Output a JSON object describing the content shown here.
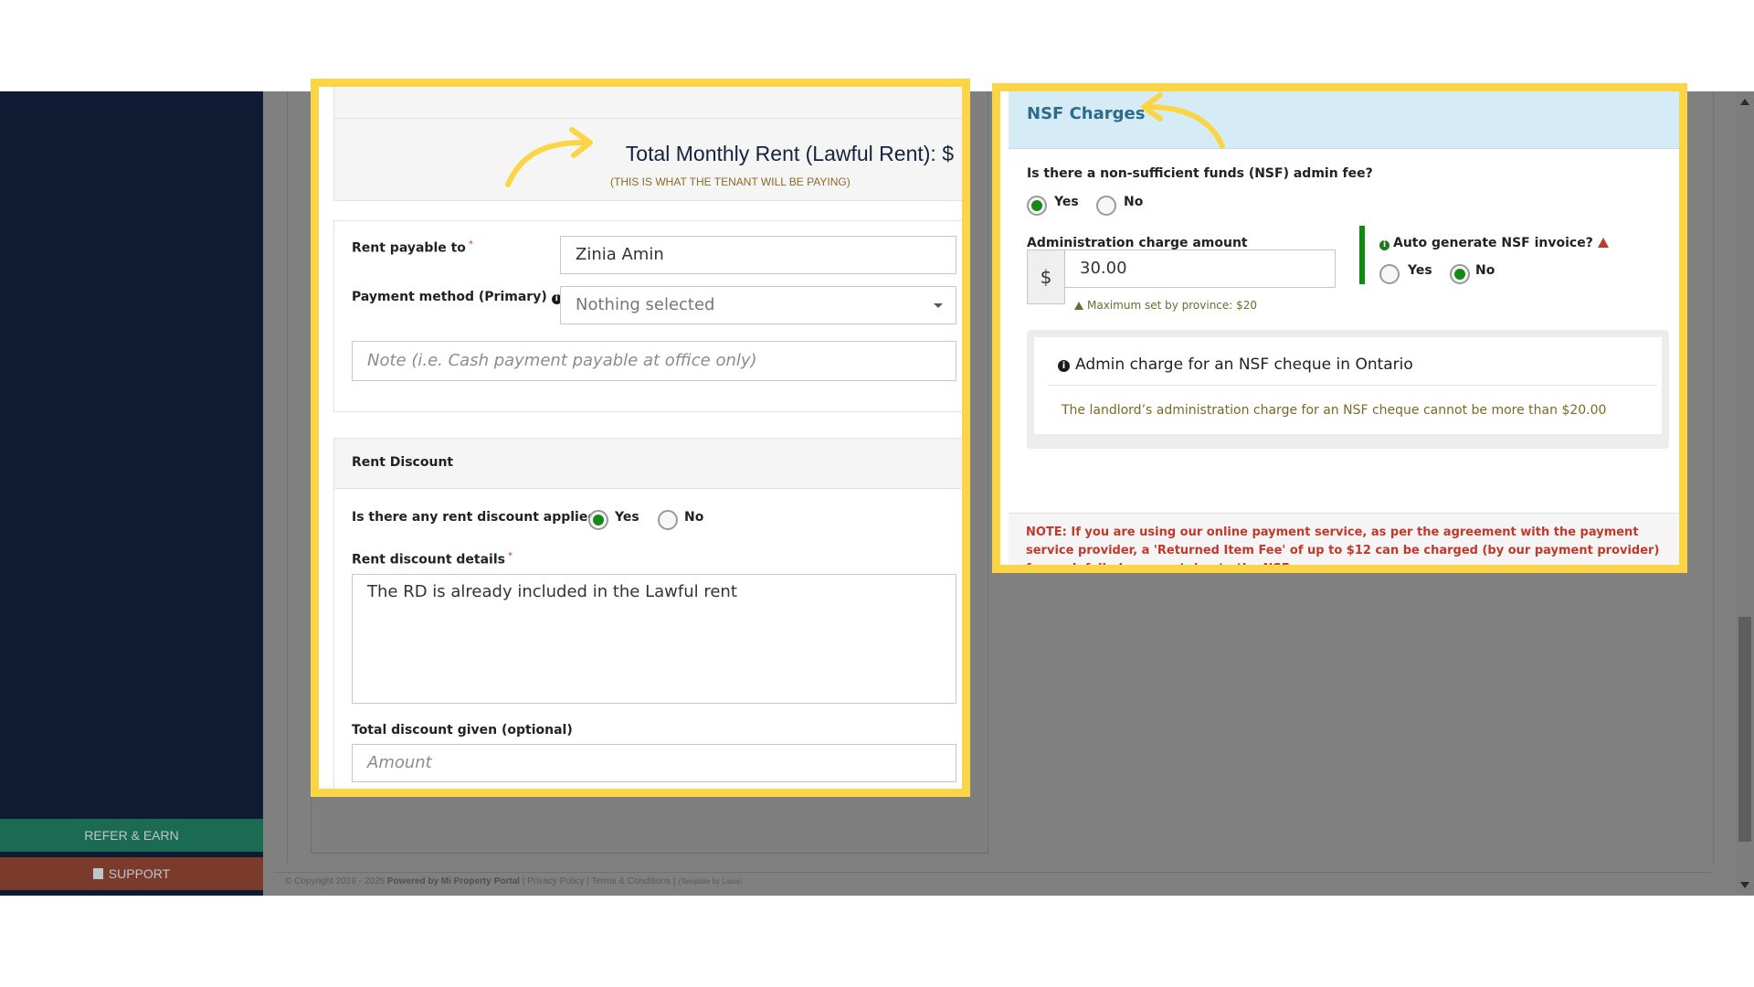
{
  "sidebar": {
    "refer_label": "REFER & EARN",
    "support_label": "SUPPORT"
  },
  "footer": {
    "copyright": "© Copyright 2016 - 2025",
    "powered_by": "Powered by Mi Property Portal",
    "privacy": "Privacy Policy",
    "terms": "Terms & Conditions",
    "template_by": "(Template by Lapia)"
  },
  "rent_section": {
    "total_title": "Total Monthly Rent (Lawful Rent): $",
    "total_subtitle": "(THIS IS WHAT THE TENANT WILL BE PAYING)",
    "rent_payable_label": "Rent payable to",
    "rent_payable_value": "Zinia Amin",
    "payment_method_label": "Payment method (Primary)",
    "payment_method_value": "Nothing selected",
    "note_placeholder": "Note (i.e. Cash payment payable at office only)"
  },
  "discount_section": {
    "header": "Rent Discount",
    "question": "Is there any rent discount applied?",
    "yes_label": "Yes",
    "no_label": "No",
    "selected": "Yes",
    "details_label": "Rent discount details",
    "details_value": "The RD is already included in the Lawful rent",
    "total_label": "Total discount given (optional)",
    "total_placeholder": "Amount"
  },
  "nsf_section": {
    "title": "NSF Charges",
    "question": "Is there a non-sufficient funds (NSF) admin fee?",
    "yes_label": "Yes",
    "no_label": "No",
    "fee_selected": "Yes",
    "admin_label": "Administration charge amount",
    "currency_symbol": "$",
    "admin_value": "30.00",
    "max_note": "Maximum set by province: $20",
    "auto_label": "Auto generate NSF invoice?",
    "auto_selected": "No",
    "ontario_title": "Admin charge for an NSF cheque in Ontario",
    "ontario_text": "The landlord’s administration charge for an NSF cheque cannot be more than $20.00",
    "note": "NOTE: If you are using our online payment service, as per the agreement with the payment service provider, a 'Returned Item Fee' of up to $12 can be charged (by our payment provider) for each failed payment due to the NSF."
  },
  "colors": {
    "highlight": "#fcd547",
    "sidebar": "#0f1a33",
    "radio_on": "#168a16",
    "nsf_header": "#d5ecf6"
  }
}
